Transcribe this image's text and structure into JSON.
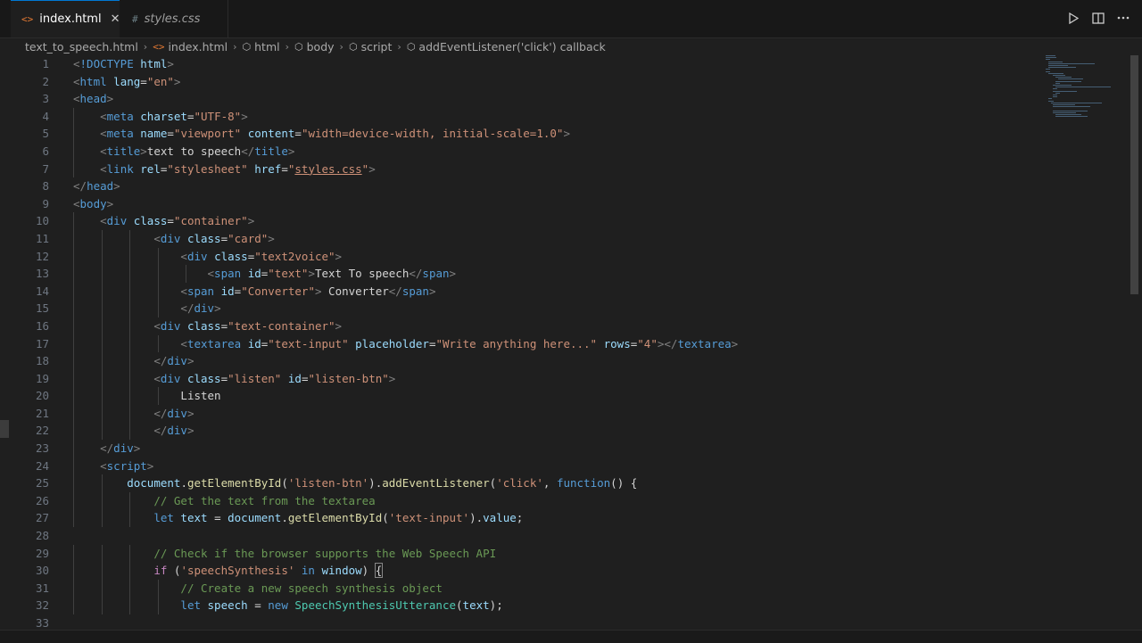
{
  "tabs": [
    {
      "label": "index.html",
      "icon": "<>",
      "active": true
    },
    {
      "label": "styles.css",
      "icon": "#",
      "active": false
    }
  ],
  "breadcrumb": [
    {
      "label": "text_to_speech.html",
      "icon": ""
    },
    {
      "label": "index.html",
      "icon": "html-file-icon"
    },
    {
      "label": "html",
      "icon": "element-icon"
    },
    {
      "label": "body",
      "icon": "element-icon"
    },
    {
      "label": "script",
      "icon": "element-icon"
    },
    {
      "label": "addEventListener('click') callback",
      "icon": "method-icon"
    }
  ],
  "code": [
    "<!DOCTYPE html>",
    "<html lang=\"en\">",
    "<head>",
    "    <meta charset=\"UTF-8\">",
    "    <meta name=\"viewport\" content=\"width=device-width, initial-scale=1.0\">",
    "    <title>text to speech</title>",
    "    <link rel=\"stylesheet\" href=\"styles.css\">",
    "</head>",
    "<body>",
    "    <div class=\"container\">",
    "            <div class=\"card\">",
    "                <div class=\"text2voice\">",
    "                    <span id=\"text\">Text To speech</span>",
    "                <span id=\"Converter\"> Converter</span>",
    "                </div>",
    "            <div class=\"text-container\">",
    "                <textarea id=\"text-input\" placeholder=\"Write anything here...\" rows=\"4\"></textarea>",
    "            </div>",
    "            <div class=\"listen\" id=\"listen-btn\">",
    "                Listen",
    "            </div>",
    "            </div>",
    "    </div>",
    "    <script>",
    "        document.getElementById('listen-btn').addEventListener('click', function() {",
    "            // Get the text from the textarea",
    "            let text = document.getElementById('text-input').value;",
    "",
    "            // Check if the browser supports the Web Speech API",
    "            if ('speechSynthesis' in window) {",
    "                // Create a new speech synthesis object",
    "                let speech = new SpeechSynthesisUtterance(text);",
    ""
  ],
  "icons": {
    "run": "run-icon",
    "split": "split-editor-icon",
    "more": "more-actions-icon"
  },
  "colors": {
    "accent": "#0078d4",
    "background": "#1f1f1f"
  }
}
